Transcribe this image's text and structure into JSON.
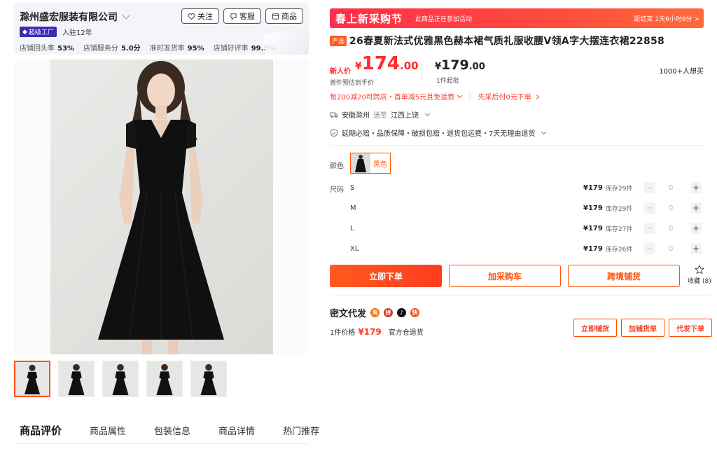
{
  "shop": {
    "name": "滁州盛宏服装有限公司",
    "follow_label": "关注",
    "service_label": "客服",
    "goods_label": "商品",
    "badge": "超级工厂",
    "years": "入驻12年",
    "stats": [
      {
        "label": "店铺回头率",
        "value": "53%"
      },
      {
        "label": "店铺服务分",
        "value": "5.0分"
      },
      {
        "label": "准时发货率",
        "value": "95%"
      },
      {
        "label": "店铺好评率",
        "value": "99.5%"
      }
    ]
  },
  "gallery": {
    "thumb_count": 5
  },
  "tabs": [
    "商品评价",
    "商品属性",
    "包装信息",
    "商品详情",
    "热门推荐"
  ],
  "promo": {
    "title": "春上新采购节",
    "note": "此商品正在参加活动",
    "countdown": "距结束 1天6小时9分 >"
  },
  "product": {
    "tag": "严选",
    "title": "26春夏新法式优雅黑色赫本裙气质礼服收腰V领A字大摆连衣裙22858"
  },
  "price": {
    "newbie_label": "新人价",
    "newbie_currency": "¥",
    "newbie_int": "174",
    "newbie_dec": ".00",
    "newbie_note": "首件预估到手价",
    "currency": "¥",
    "int": "179",
    "dec": ".00",
    "min_order": "1件起批",
    "want": "1000+人想买"
  },
  "promos": {
    "coupon": "每200减20可跨店・首单减5元且免运费",
    "pay_later": "先采后付0元下单"
  },
  "shipping": {
    "from": "安徽滁州",
    "to_label": "送至",
    "to": "江西上饶"
  },
  "guarantee": "延期必赔・品质保障・破损包赔・退货包运费・7天无理由退货",
  "color": {
    "label": "颜色",
    "selected": "黑色"
  },
  "size": {
    "label": "尺码",
    "rows": [
      {
        "name": "S",
        "price": "¥179",
        "stock": "库存29件",
        "qty": "0"
      },
      {
        "name": "M",
        "price": "¥179",
        "stock": "库存29件",
        "qty": "0"
      },
      {
        "name": "L",
        "price": "¥179",
        "stock": "库存27件",
        "qty": "0"
      },
      {
        "name": "XL",
        "price": "¥179",
        "stock": "库存26件",
        "qty": "0"
      }
    ]
  },
  "actions": {
    "buy_now": "立即下单",
    "add_cart": "加采购车",
    "cross_border": "跨境铺货",
    "favorite": "收藏 (8)"
  },
  "secret": {
    "title": "密文代发",
    "unit_label": "1件价格",
    "unit_price": "¥179",
    "return_note": "官方仓退货",
    "btn_list": "立即铺货",
    "btn_add": "加铺货单",
    "btn_order": "代发下单"
  },
  "colors": {
    "accent": "#ff5000",
    "price_red": "#ff2c2c",
    "banner_red": "#ff2e4a"
  }
}
